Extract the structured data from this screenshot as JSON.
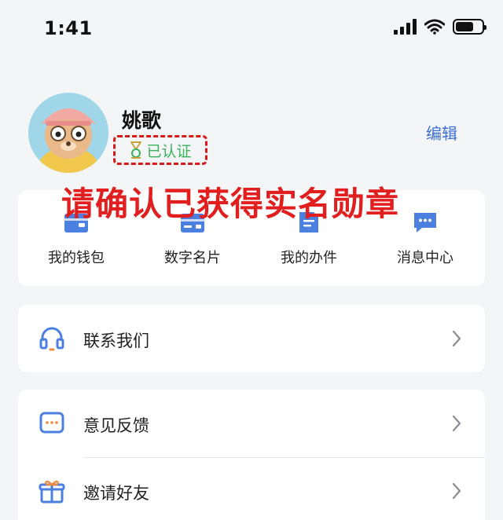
{
  "status_bar": {
    "time": "1:41"
  },
  "profile": {
    "name": "姚歌",
    "verified_label": "已认证",
    "edit_label": "编辑"
  },
  "annotation": "请确认已获得实名勋章",
  "quick_actions": [
    {
      "label": "我的钱包",
      "icon": "wallet-icon"
    },
    {
      "label": "数字名片",
      "icon": "card-icon"
    },
    {
      "label": "我的办件",
      "icon": "document-icon"
    },
    {
      "label": "消息中心",
      "icon": "message-icon"
    }
  ],
  "menu": {
    "contact": {
      "label": "联系我们",
      "icon": "headset-icon"
    },
    "feedback": {
      "label": "意见反馈",
      "icon": "feedback-icon"
    },
    "invite": {
      "label": "邀请好友",
      "icon": "gift-icon"
    }
  },
  "colors": {
    "accent": "#3b6fd3",
    "annotation_red": "#e11f1f",
    "verified_green": "#38b35a",
    "background": "#f4f5f7"
  }
}
